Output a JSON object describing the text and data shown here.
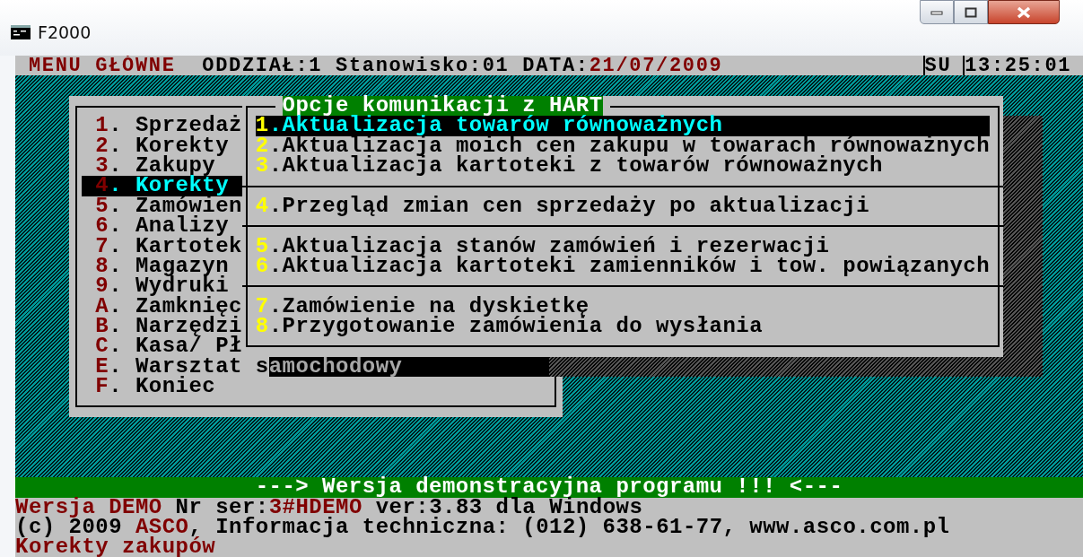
{
  "window": {
    "title": "F2000"
  },
  "header": {
    "title": "MENU GŁÓWNE",
    "info": "ODDZIAŁ:1 Stanowisko:01 DATA:",
    "date": "21/07/2009",
    "user": "SU",
    "time": "13:25:01"
  },
  "main_menu": {
    "items": [
      {
        "key": "1",
        "label": ". Sprzedaż",
        "selected": false
      },
      {
        "key": "2",
        "label": ". Korekty",
        "selected": false
      },
      {
        "key": "3",
        "label": ". Zakupy",
        "selected": false
      },
      {
        "key": "4",
        "label": ". Korekty",
        "selected": true
      },
      {
        "key": "5",
        "label": ". Zamówien",
        "selected": false
      },
      {
        "key": "6",
        "label": ". Analizy",
        "selected": false
      },
      {
        "key": "7",
        "label": ". Kartotek",
        "selected": false
      },
      {
        "key": "8",
        "label": ". Magazyn",
        "selected": false
      },
      {
        "key": "9",
        "label": ". Wydruki",
        "selected": false
      },
      {
        "key": "A",
        "label": ". Zamknięc",
        "selected": false
      },
      {
        "key": "B",
        "label": ". Narzędzi",
        "selected": false
      },
      {
        "key": "C",
        "label": ". Kasa/ Pł",
        "selected": false
      },
      {
        "key": "E",
        "label": ". Warsztat s",
        "selected": false
      },
      {
        "key": "F",
        "label": ". Koniec",
        "selected": false
      }
    ],
    "field_remnant": "amochodowy"
  },
  "dialog": {
    "title": "Opcje komunikacji z HART",
    "groups": [
      [
        {
          "key": "1",
          "label": ".Aktualizacja towarów równoważnych",
          "selected": true
        },
        {
          "key": "2",
          "label": ".Aktualizacja moich cen zakupu w towarach równoważnych",
          "selected": false
        },
        {
          "key": "3",
          "label": ".Aktualizacja kartoteki z towarów równoważnych",
          "selected": false
        }
      ],
      [
        {
          "key": "4",
          "label": ".Przegląd zmian cen sprzedaży po aktualizacji",
          "selected": false
        }
      ],
      [
        {
          "key": "5",
          "label": ".Aktualizacja stanów zamówień i rezerwacji",
          "selected": false
        },
        {
          "key": "6",
          "label": ".Aktualizacja kartoteki zamienników i tow. powiązanych",
          "selected": false
        }
      ],
      [
        {
          "key": "7",
          "label": ".Zamówienie na dyskietkę",
          "selected": false
        },
        {
          "key": "8",
          "label": ".Przygotowanie zamówienia do wysłania",
          "selected": false
        }
      ]
    ]
  },
  "banner": "---> Wersja demonstracyjna programu !!! <---",
  "info_lines": [
    [
      {
        "text": "Wersja DEMO",
        "accent": true
      },
      {
        "text": " Nr ser:",
        "accent": false
      },
      {
        "text": "3#HDEMO",
        "accent": true
      },
      {
        "text": " ver:3.83 dla Windows",
        "accent": false
      }
    ],
    [
      {
        "text": "(c) 2009 ",
        "accent": false
      },
      {
        "text": "ASCO",
        "accent": true
      },
      {
        "text": ", Informacja techniczna: (012) 638-61-77, www.asco.com.pl",
        "accent": false
      }
    ]
  ],
  "status": "Korekty zakupów"
}
